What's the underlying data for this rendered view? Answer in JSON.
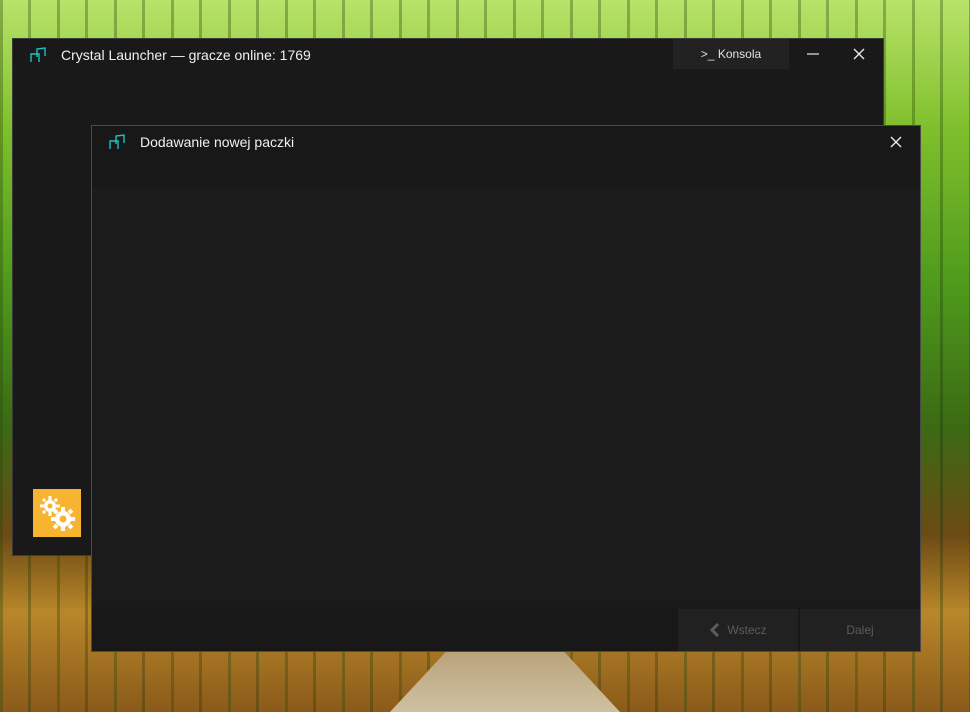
{
  "main_window": {
    "title": "Crystal Launcher — gracze online: 1769",
    "console_label": ">_ Konsola"
  },
  "dialog": {
    "title": "Dodawanie nowej paczki",
    "back_label": "Wstecz",
    "next_label": "Dalej"
  },
  "icons": {
    "app": "crystal-launcher-icon",
    "settings": "gears-icon",
    "minimize": "minimize-icon",
    "close": "close-icon",
    "back": "chevron-left-icon"
  },
  "colors": {
    "accent": "#1fc1c1",
    "settings_bg": "#f6b431",
    "window_bg": "#191919"
  }
}
